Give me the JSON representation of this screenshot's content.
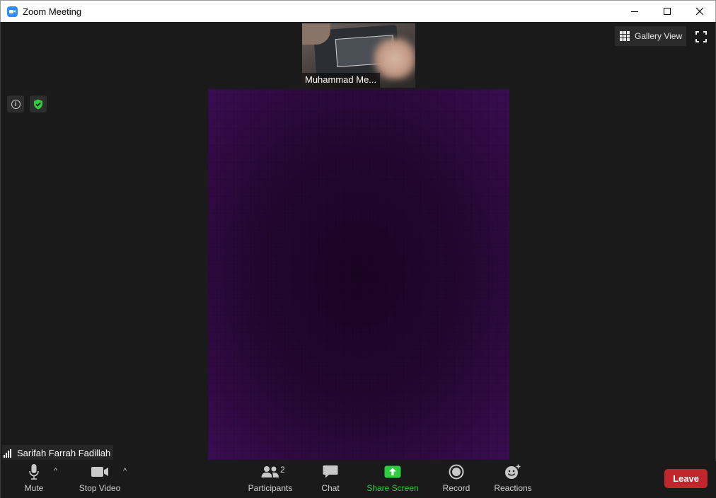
{
  "window": {
    "title": "Zoom Meeting"
  },
  "thumbnail": {
    "name": "Muhammad Me..."
  },
  "view": {
    "gallery_label": "Gallery View"
  },
  "self_view": {
    "name": "Sarifah Farrah Fadillah"
  },
  "toolbar": {
    "mute_label": "Mute",
    "stop_video_label": "Stop Video",
    "participants_label": "Participants",
    "participants_count": "2",
    "chat_label": "Chat",
    "share_label": "Share Screen",
    "record_label": "Record",
    "reactions_label": "Reactions",
    "leave_label": "Leave"
  },
  "colors": {
    "share_accent": "#2ecc40",
    "leave_bg": "#c0272d",
    "zoom_blue": "#2d8cff",
    "encryption_green": "#2ecc40"
  },
  "icons": {
    "info": "i",
    "caret": "^"
  }
}
